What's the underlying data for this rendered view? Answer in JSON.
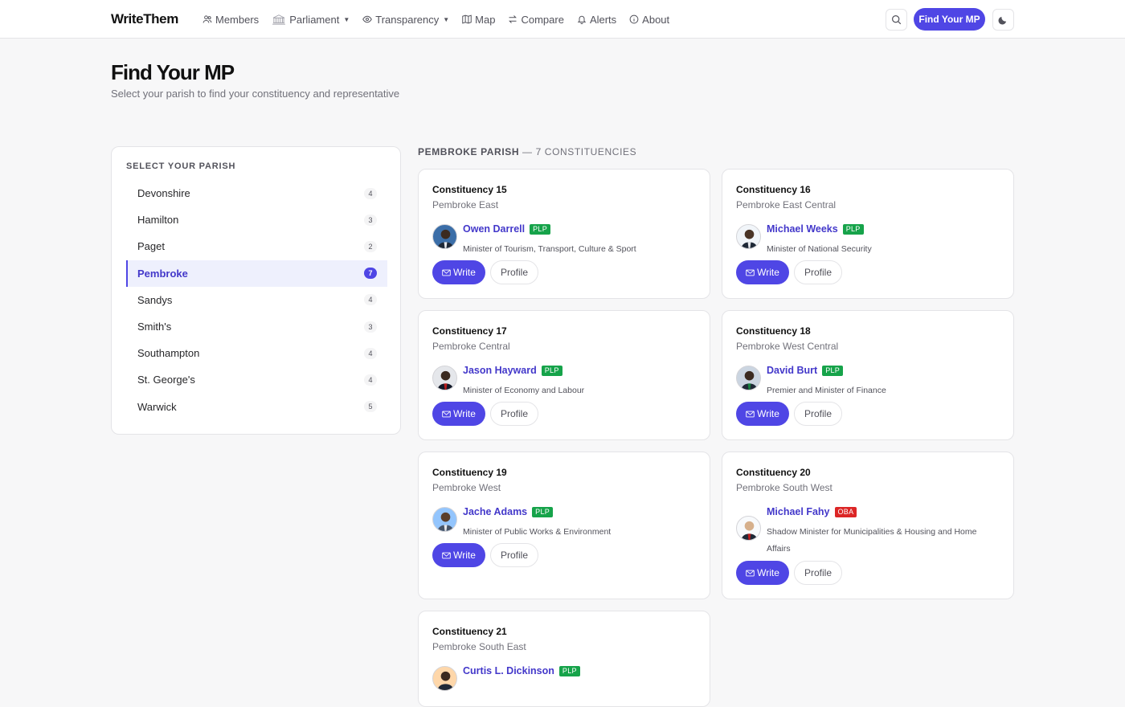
{
  "app": {
    "brand": "WriteThem"
  },
  "nav": {
    "items": [
      {
        "label": "Members",
        "icon": "users-icon"
      },
      {
        "label": "Parliament",
        "icon": "parliament-icon",
        "dropdown": true
      },
      {
        "label": "Transparency",
        "icon": "eye-icon",
        "dropdown": true
      },
      {
        "label": "Map",
        "icon": "map-icon"
      },
      {
        "label": "Compare",
        "icon": "compare-arrows-icon"
      },
      {
        "label": "Alerts",
        "icon": "bell-icon"
      },
      {
        "label": "About",
        "icon": "info-icon"
      }
    ],
    "find_button": "Find Your MP"
  },
  "page": {
    "title": "Find Your MP",
    "subtitle": "Select your parish to find your constituency and representative"
  },
  "parish_panel": {
    "heading": "SELECT YOUR PARISH",
    "selected": "Pembroke",
    "items": [
      {
        "name": "Devonshire",
        "count": "4"
      },
      {
        "name": "Hamilton",
        "count": "3"
      },
      {
        "name": "Paget",
        "count": "2"
      },
      {
        "name": "Pembroke",
        "count": "7"
      },
      {
        "name": "Sandys",
        "count": "4"
      },
      {
        "name": "Smith's",
        "count": "3"
      },
      {
        "name": "Southampton",
        "count": "4"
      },
      {
        "name": "St. George's",
        "count": "4"
      },
      {
        "name": "Warwick",
        "count": "5"
      }
    ]
  },
  "results": {
    "heading_strong": "PEMBROKE PARISH",
    "heading_rest": " — 7 CONSTITUENCIES",
    "write_label": "Write",
    "profile_label": "Profile",
    "constituencies": [
      {
        "title": "Constituency 15",
        "area": "Pembroke East",
        "mp": "Owen Darrell",
        "party": "PLP",
        "role": "Minister of Tourism, Transport, Culture & Sport"
      },
      {
        "title": "Constituency 16",
        "area": "Pembroke East Central",
        "mp": "Michael Weeks",
        "party": "PLP",
        "role": "Minister of National Security"
      },
      {
        "title": "Constituency 17",
        "area": "Pembroke Central",
        "mp": "Jason Hayward",
        "party": "PLP",
        "role": "Minister of Economy and Labour"
      },
      {
        "title": "Constituency 18",
        "area": "Pembroke West Central",
        "mp": "David Burt",
        "party": "PLP",
        "role": "Premier and Minister of Finance"
      },
      {
        "title": "Constituency 19",
        "area": "Pembroke West",
        "mp": "Jache Adams",
        "party": "PLP",
        "role": "Minister of Public Works & Environment"
      },
      {
        "title": "Constituency 20",
        "area": "Pembroke South West",
        "mp": "Michael Fahy",
        "party": "OBA",
        "role": "Shadow Minister for Municipalities & Housing and Home Affairs"
      },
      {
        "title": "Constituency 21",
        "area": "Pembroke South East",
        "mp": "Curtis L. Dickinson",
        "party": "PLP",
        "role": ""
      }
    ]
  },
  "colors": {
    "accent": "#4f46e5",
    "plp": "#16a34a",
    "oba": "#dc2626"
  }
}
